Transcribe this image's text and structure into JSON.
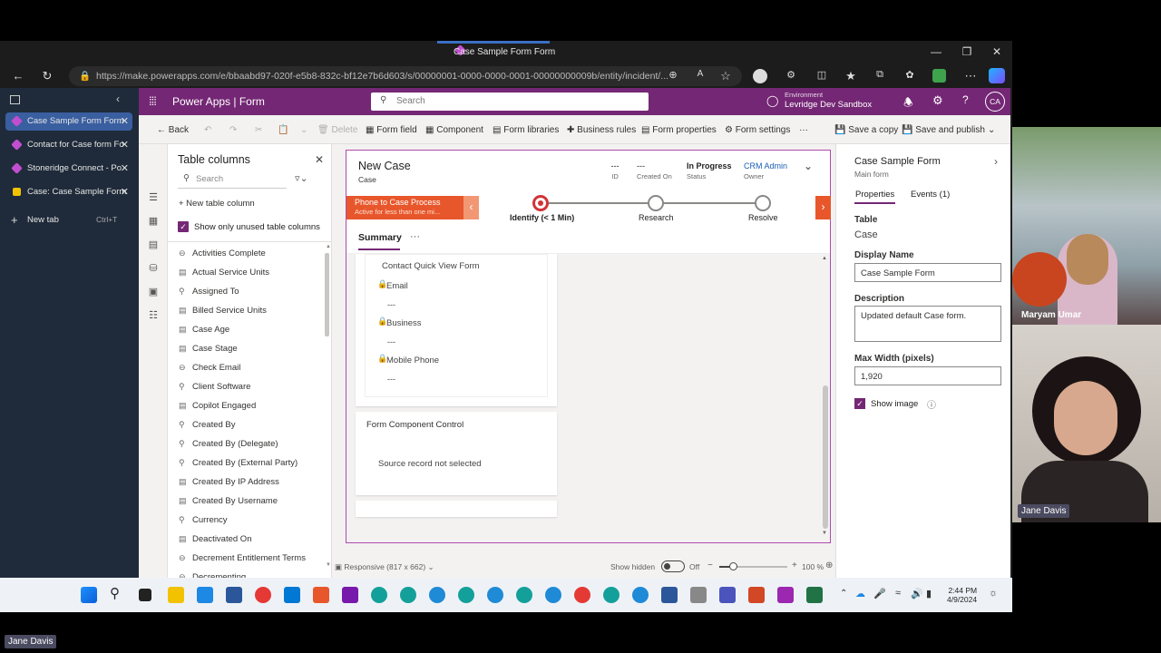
{
  "browser": {
    "window_title": "Case Sample Form Form",
    "url": "https://make.powerapps.com/e/bbaabd97-020f-e5b8-832c-bf12e7b6d603/s/00000001-0000-0000-0001-00000000009b/entity/incident/..."
  },
  "tabs": [
    {
      "label": "Case Sample Form Form",
      "active": true
    },
    {
      "label": "Contact for Case form Fo",
      "active": false
    },
    {
      "label": "Stoneridge Connect - Po",
      "active": false
    },
    {
      "label": "Case: Case Sample Form",
      "active": false
    }
  ],
  "new_tab": {
    "label": "New tab",
    "shortcut": "Ctrl+T"
  },
  "header": {
    "brand": "Power Apps  |  Form",
    "search_placeholder": "Search",
    "env_label": "Environment",
    "env_name": "Levridge Dev Sandbox",
    "avatar": "CA"
  },
  "commands": {
    "back": "Back",
    "delete": "Delete",
    "form_field": "Form field",
    "component": "Component",
    "form_libraries": "Form libraries",
    "business_rules": "Business rules",
    "form_properties": "Form properties",
    "form_settings": "Form settings",
    "more": "···",
    "save_copy": "Save a copy",
    "save_publish": "Save and publish"
  },
  "table_columns": {
    "title": "Table columns",
    "search_placeholder": "Search",
    "new_column": "+ New table column",
    "show_unused": "Show only unused table columns",
    "items": [
      "Activities Complete",
      "Actual Service Units",
      "Assigned To",
      "Billed Service Units",
      "Case Age",
      "Case Stage",
      "Check Email",
      "Client Software",
      "Copilot Engaged",
      "Created By",
      "Created By (Delegate)",
      "Created By (External Party)",
      "Created By IP Address",
      "Created By Username",
      "Currency",
      "Deactivated On",
      "Decrement Entitlement Terms",
      "Decrementing"
    ]
  },
  "form": {
    "title": "New Case",
    "subtitle": "Case",
    "fields": [
      {
        "value": "---",
        "label": "ID"
      },
      {
        "value": "---",
        "label": "Created On"
      },
      {
        "value": "In Progress",
        "label": "Status"
      },
      {
        "value": "CRM Admin",
        "label": "Owner"
      }
    ],
    "process": {
      "name": "Phone to Case Process",
      "sub": "Active for less than one mi..."
    },
    "stages": [
      "Identify  (< 1 Min)",
      "Research",
      "Resolve"
    ],
    "tab_summary": "Summary",
    "tab_more": "···",
    "quick_view": "Contact Quick View Form",
    "qv_fields": [
      {
        "label": "Email",
        "value": "---"
      },
      {
        "label": "Business",
        "value": "---"
      },
      {
        "label": "Mobile Phone",
        "value": "---"
      }
    ],
    "component_title": "Form Component Control",
    "component_msg": "Source record not selected"
  },
  "status": {
    "responsive": "Responsive (817 x 662)",
    "show_hidden": "Show hidden",
    "toggle": "Off",
    "zoom": "100 %",
    "zoom_level": 0.2
  },
  "props": {
    "title": "Case Sample Form",
    "subtitle": "Main form",
    "tab_props": "Properties",
    "tab_events": "Events (1)",
    "table_lbl": "Table",
    "table_val": "Case",
    "display_lbl": "Display Name",
    "display_val": "Case Sample Form",
    "desc_lbl": "Description",
    "desc_val": "Updated default Case form.",
    "maxw_lbl": "Max Width (pixels)",
    "maxw_val": "1,920",
    "show_image": "Show image"
  },
  "clock": {
    "time": "2:44 PM",
    "date": "4/9/2024"
  },
  "participants": {
    "first": "Maryam Umar",
    "second": "Jane Davis",
    "self": "Jane Davis"
  },
  "colors": {
    "accent": "#742774",
    "process": "#e8572b",
    "stage": "#d13438"
  }
}
